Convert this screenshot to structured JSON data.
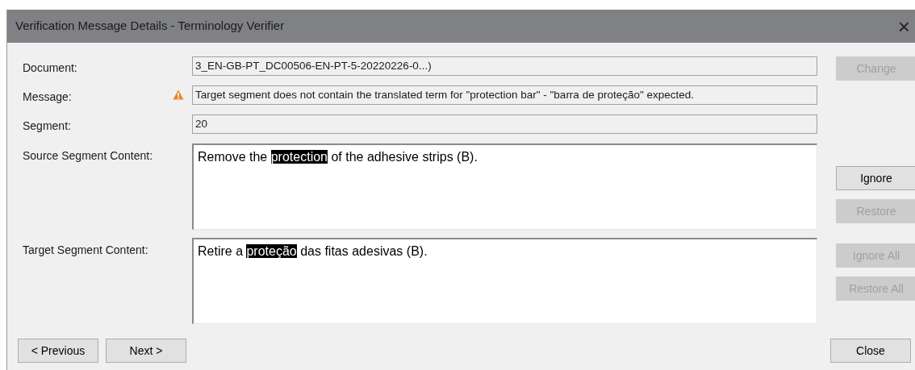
{
  "window": {
    "title": "Verification Message Details - Terminology Verifier",
    "close": "×"
  },
  "fields": [
    {
      "kind": "line",
      "label": "Document:",
      "value": "3_EN-GB-PT_DC00506-EN-PT-5-20220226-0...)",
      "warning": false
    },
    {
      "kind": "line",
      "label": "Message:",
      "value": "Target segment does not contain the translated term for \"protection bar\" - \"barra de proteção\" expected.",
      "warning": true
    },
    {
      "kind": "line",
      "label": "Segment:",
      "value": "20",
      "warning": false
    },
    {
      "kind": "content",
      "label": "Source Segment Content:",
      "before": "Remove the ",
      "highlighted": "protection",
      "after": " of the adhesive strips (B).",
      "warning": false
    },
    {
      "kind": "content",
      "label": "Target Segment Content:",
      "before": "Retire a ",
      "highlighted": "proteção",
      "after": " das fitas adesivas (B).",
      "warning": false
    }
  ],
  "side_buttons": [
    {
      "label": "Change",
      "disabled": true
    },
    {
      "label": "Ignore",
      "disabled": false
    },
    {
      "label": "Restore",
      "disabled": true
    },
    {
      "label": "Ignore All",
      "disabled": true
    },
    {
      "label": "Restore All",
      "disabled": true
    }
  ],
  "nav_buttons": [
    {
      "label": "< Previous",
      "disabled": false
    },
    {
      "label": "Next >",
      "disabled": false
    }
  ],
  "close_button": {
    "label": "Close",
    "disabled": false
  }
}
